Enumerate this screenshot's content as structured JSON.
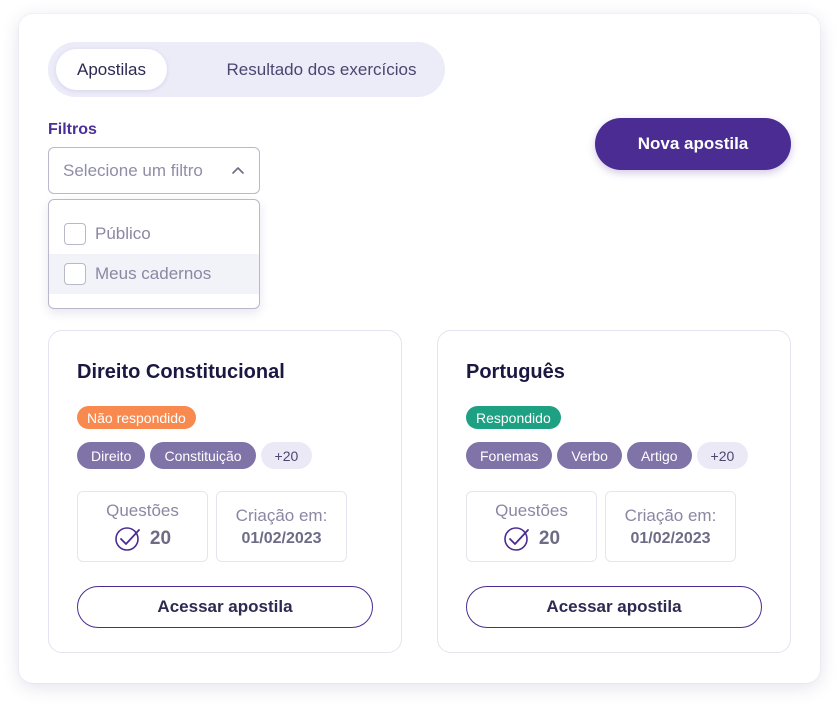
{
  "tabs": [
    {
      "label": "Apostilas",
      "active": true
    },
    {
      "label": "Resultado dos exercícios",
      "active": false
    }
  ],
  "filter": {
    "label": "Filtros",
    "placeholder": "Selecione um filtro",
    "options": [
      {
        "label": "Público",
        "checked": false
      },
      {
        "label": "Meus cadernos",
        "checked": false,
        "hovered": true
      }
    ]
  },
  "new_button": {
    "label": "Nova apostila"
  },
  "cards": [
    {
      "title": "Direito Constitucional",
      "status": {
        "label": "Não respondido",
        "color": "#f98a4f"
      },
      "tags": [
        "Direito",
        "Constituição"
      ],
      "more_tags": "+20",
      "questions_label": "Questões",
      "questions_value": "20",
      "created_label": "Criação em:",
      "created_value": "01/02/2023",
      "button": "Acessar apostila"
    },
    {
      "title": "Português",
      "status": {
        "label": "Respondido",
        "color": "#1ea183"
      },
      "tags": [
        "Fonemas",
        "Verbo",
        "Artigo"
      ],
      "more_tags": "+20",
      "questions_label": "Questões",
      "questions_value": "20",
      "created_label": "Criação em:",
      "created_value": "01/02/2023",
      "button": "Acessar apostila"
    }
  ],
  "colors": {
    "primary": "#4a2c92",
    "tag": "#7f73a8",
    "tab_bg": "#ecebf8"
  }
}
